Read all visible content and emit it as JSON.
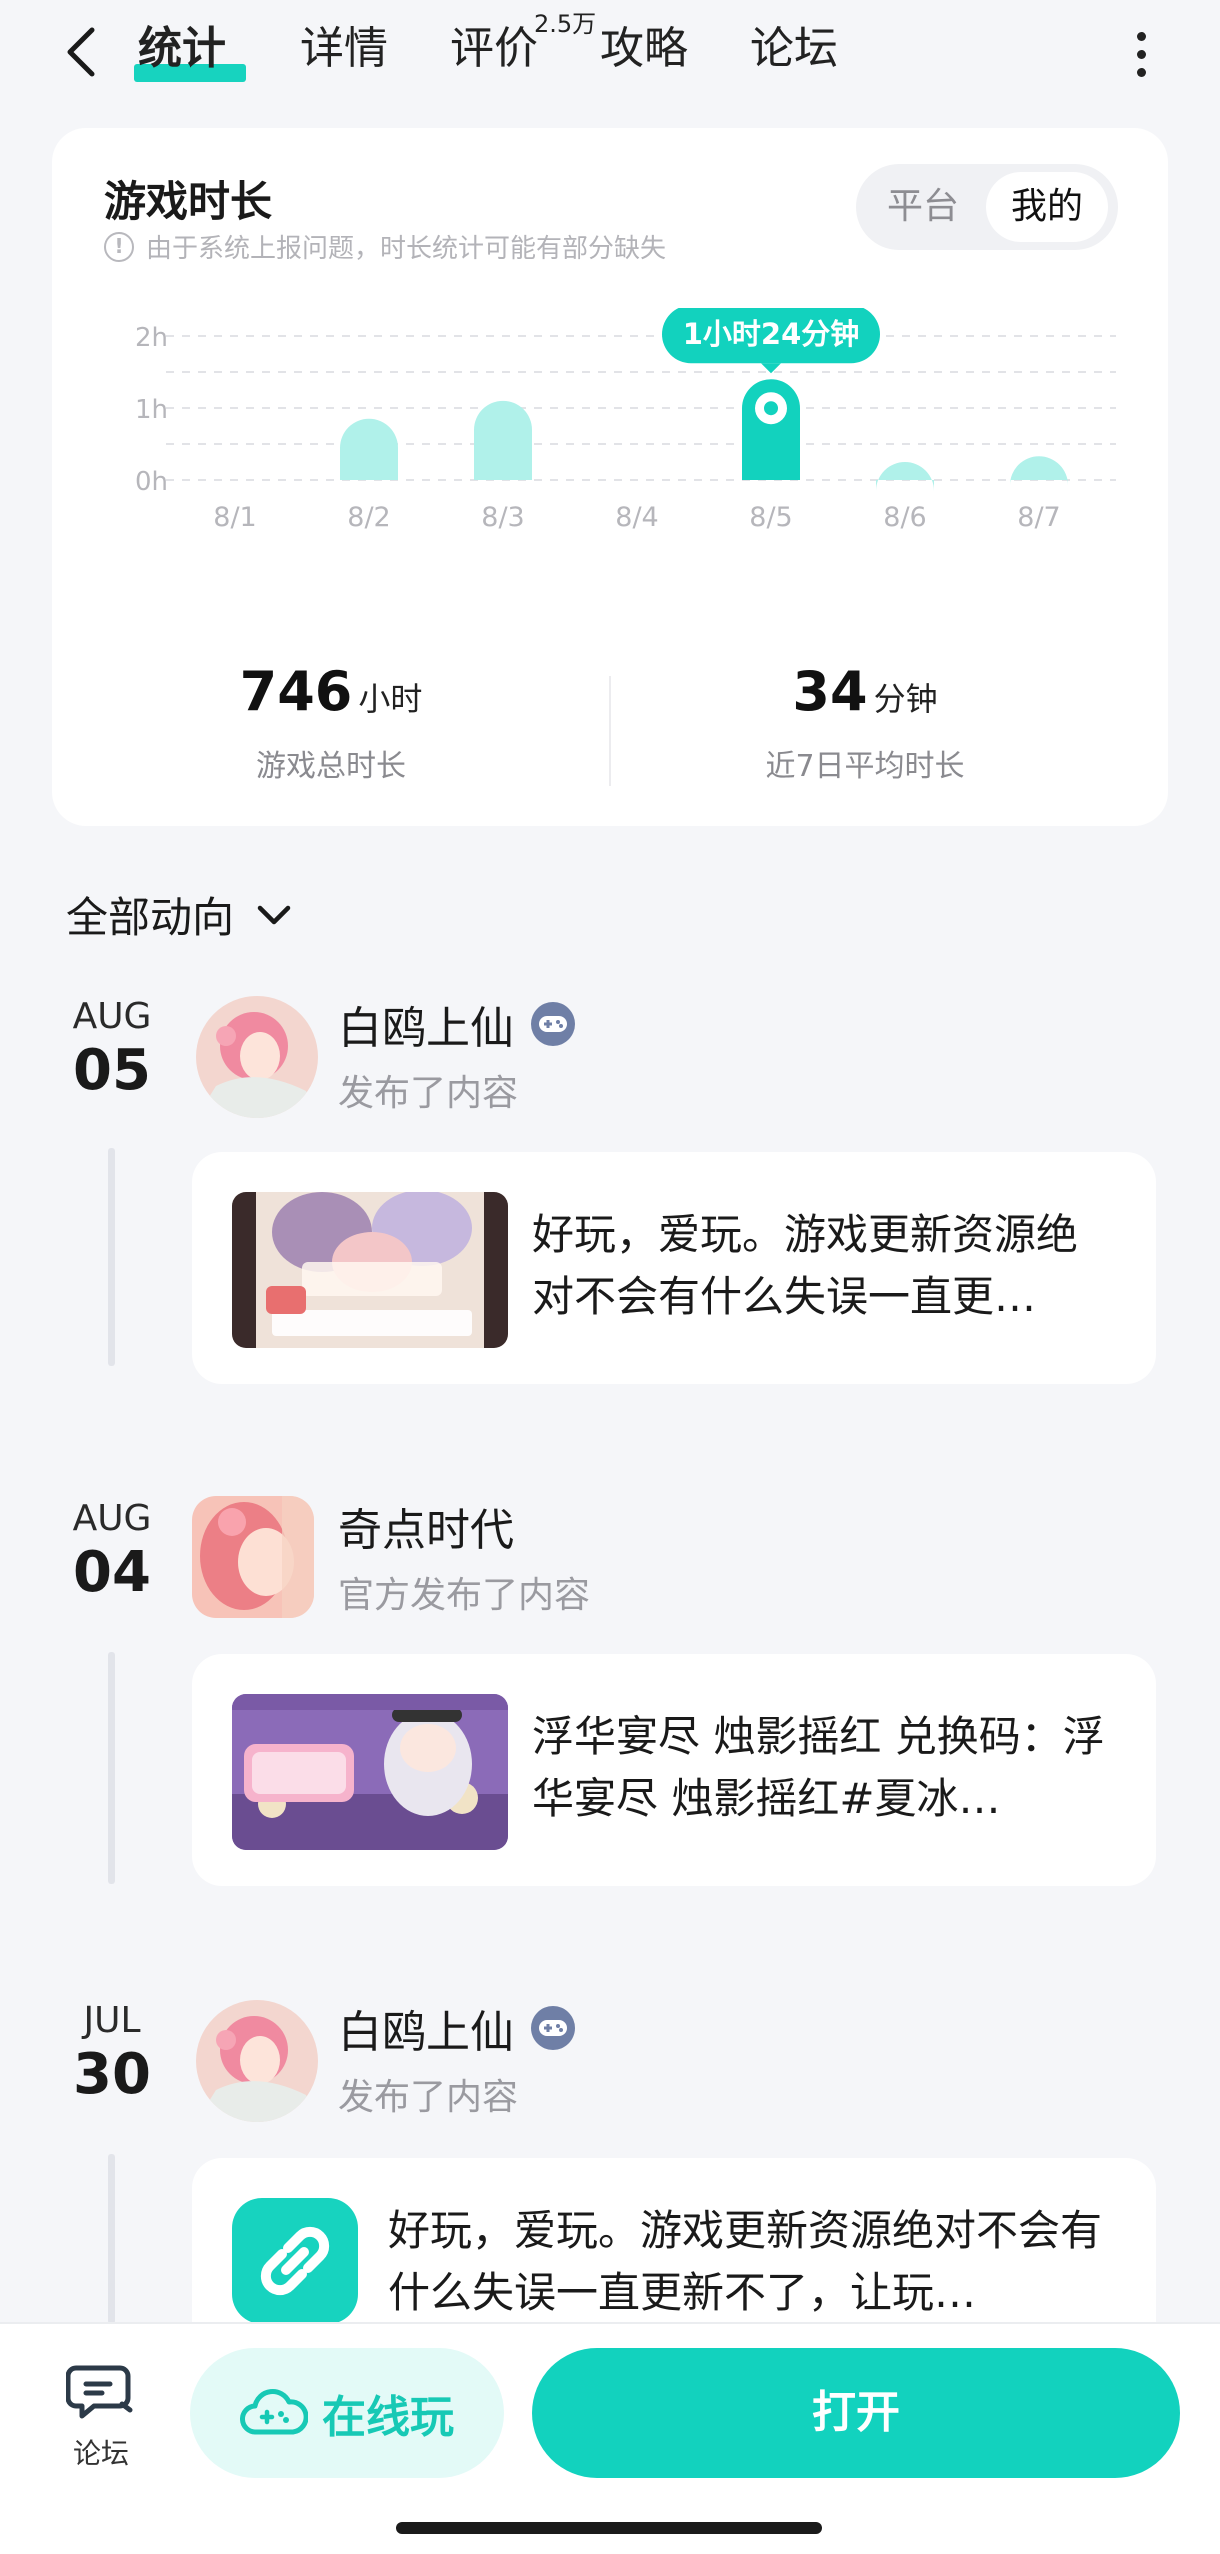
{
  "nav": {
    "tabs": [
      {
        "label": "统计",
        "active": true
      },
      {
        "label": "详情"
      },
      {
        "label": "评价"
      },
      {
        "label": "攻略"
      },
      {
        "label": "论坛"
      }
    ],
    "review_badge": "2.5万"
  },
  "stats": {
    "title": "游戏时长",
    "note": "由于系统上报问题，时长统计可能有部分缺失",
    "toggle": {
      "options": [
        "平台",
        "我的"
      ],
      "selected": "我的"
    },
    "total": {
      "value": "746",
      "unit": "小时",
      "label": "游戏总时长"
    },
    "average": {
      "value": "34",
      "unit": "分钟",
      "label": "近7日平均时长"
    }
  },
  "chart_data": {
    "type": "bar",
    "categories": [
      "8/1",
      "8/2",
      "8/3",
      "8/4",
      "8/5",
      "8/6",
      "8/7"
    ],
    "values": [
      0,
      0.85,
      1.1,
      0,
      1.4,
      0.25,
      0.33
    ],
    "highlight_index": 4,
    "highlight_label": "1小时24分钟",
    "y_ticks": [
      "0h",
      "1h",
      "2h"
    ],
    "ylim": [
      0,
      2
    ],
    "grid": true,
    "colors": {
      "bar": "#b0f1ea",
      "highlight": "#12d2be"
    }
  },
  "feed": {
    "filter_label": "全部动向",
    "entries": [
      {
        "month": "AUG",
        "day": "05",
        "author": "白鸥上仙",
        "action": "发布了内容",
        "text": "好玩，爱玩。游戏更新资源绝对不会有什么失误一直更…",
        "thumb": "event-banner-image"
      },
      {
        "month": "AUG",
        "day": "04",
        "author": "奇点时代",
        "action": "官方发布了内容",
        "text": "浮华宴尽 烛影摇红 兑换码：浮华宴尽 烛影摇红#夏冰…",
        "thumb": "birthday-banner-image"
      },
      {
        "month": "JUL",
        "day": "30",
        "author": "白鸥上仙",
        "action": "发布了内容",
        "text": "好玩，爱玩。游戏更新资源绝对不会有什么失误一直更新不了，让玩…",
        "thumb": "link-icon"
      }
    ]
  },
  "bottom": {
    "forum_label": "论坛",
    "online_label": "在线玩",
    "open_label": "打开"
  },
  "colors": {
    "accent": "#12d2be",
    "accent_light": "#b0f1ea",
    "background": "#f5f6f9"
  }
}
